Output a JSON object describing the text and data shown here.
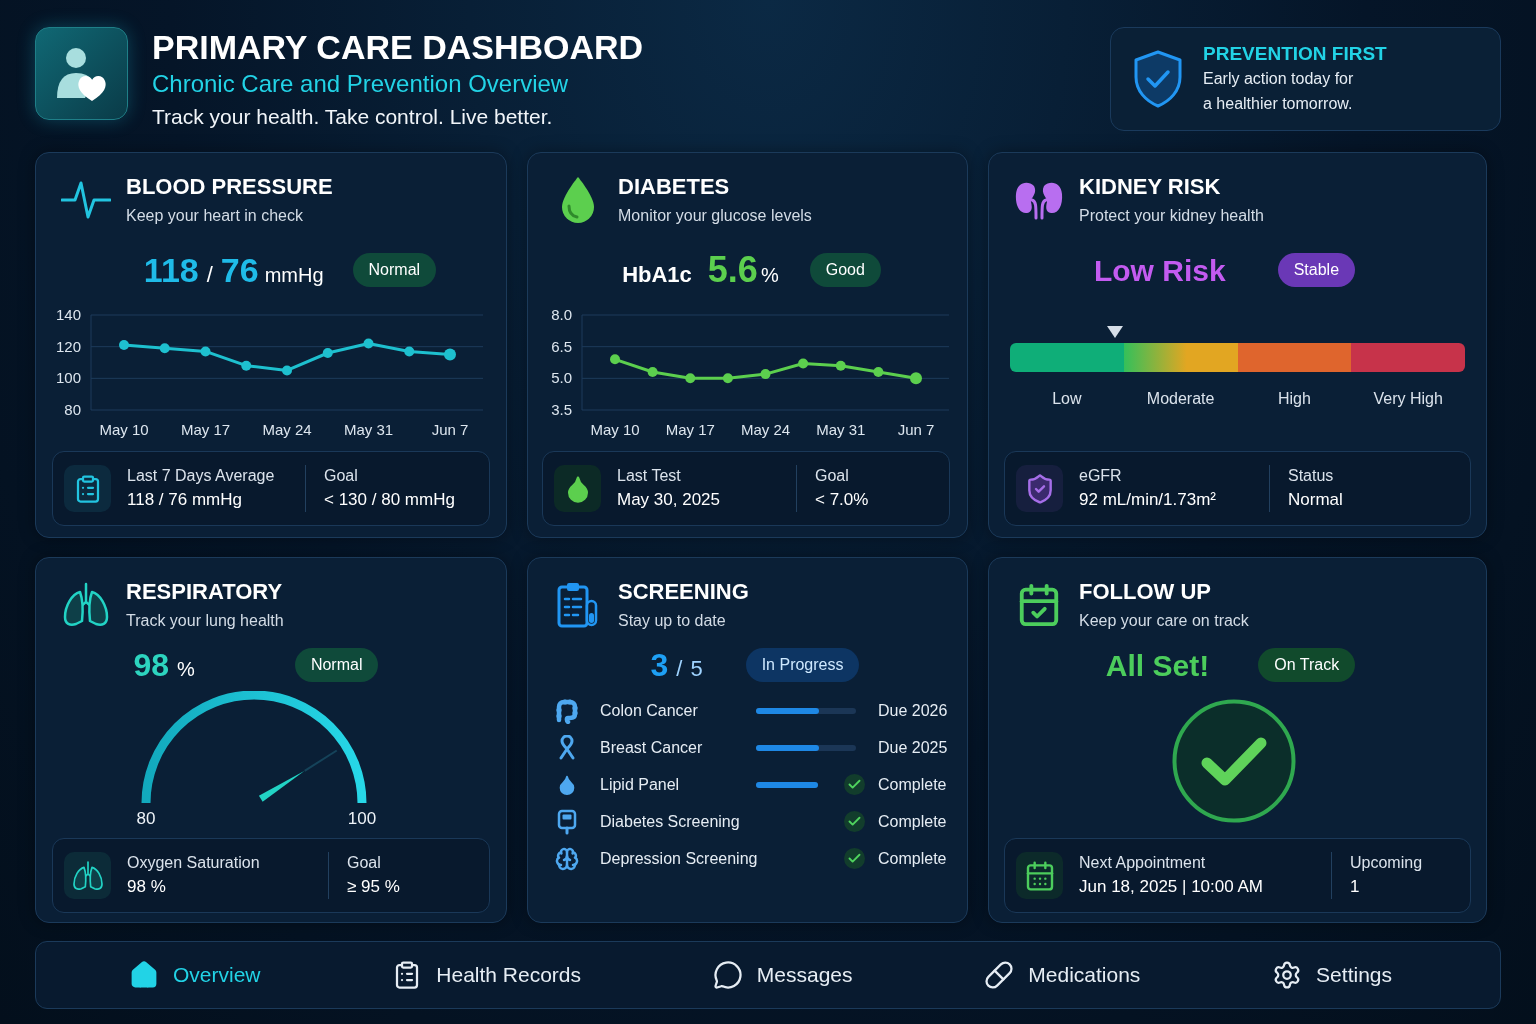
{
  "header": {
    "title": "PRIMARY CARE DASHBOARD",
    "subtitle": "Chronic Care and Prevention Overview",
    "tagline": "Track your health. Take control. Live better."
  },
  "prevention": {
    "title": "PREVENTION FIRST",
    "lines": [
      "Early action today for",
      "a healthier tomorrow."
    ]
  },
  "blood_pressure": {
    "title": "BLOOD PRESSURE",
    "subtitle": "Keep your heart in check",
    "reading": {
      "systolic": "118",
      "separator": "/",
      "diastolic": "76",
      "unit": "mmHg"
    },
    "badge": "Normal",
    "chart_data": {
      "type": "line",
      "marker": "circle",
      "categories": [
        "May 10",
        null,
        "May 17",
        null,
        "May 24",
        null,
        "May 31",
        null,
        "Jun 7"
      ],
      "values": [
        121,
        119,
        117,
        108,
        105,
        116,
        122,
        117,
        115
      ],
      "ylim": [
        80,
        140
      ],
      "yticks": [
        80,
        100,
        120,
        140
      ]
    },
    "summary": [
      {
        "label": "Last 7 Days Average",
        "value": "118 / 76 mmHg"
      },
      {
        "label": "Goal",
        "value": "< 130 / 80 mmHg"
      }
    ]
  },
  "diabetes": {
    "title": "DIABETES",
    "subtitle": "Monitor your glucose levels",
    "reading": {
      "label": "HbA1c",
      "value": "5.6",
      "unit": "%"
    },
    "badge": "Good",
    "chart_data": {
      "type": "line",
      "marker": "circle",
      "categories": [
        "May 10",
        null,
        "May 17",
        null,
        "May 24",
        null,
        "May 31",
        null,
        "Jun 7"
      ],
      "values": [
        5.9,
        5.3,
        5.0,
        5.0,
        5.2,
        5.7,
        5.6,
        5.3,
        5.0
      ],
      "ylim": [
        3.5,
        8.0
      ],
      "yticks": [
        {
          "value": 3.5,
          "label": "3.5"
        },
        {
          "value": 5,
          "label": "5.0"
        },
        {
          "value": 6.5,
          "label": "6.5"
        },
        {
          "value": 8,
          "label": "8.0"
        }
      ]
    },
    "summary": [
      {
        "label": "Last Test",
        "value": "May 30, 2025"
      },
      {
        "label": "Goal",
        "value": "< 7.0%"
      }
    ]
  },
  "kidney_risk": {
    "title": "KIDNEY RISK",
    "subtitle": "Protect your kidney health",
    "reading": {
      "value": "Low Risk"
    },
    "badge": "Stable",
    "scale": {
      "level": 0.23,
      "segments": [
        {
          "label": "Low",
          "color": "#0fae78"
        },
        {
          "label": "Moderate",
          "color": "#e2a622"
        },
        {
          "label": "High",
          "color": "#df652d"
        },
        {
          "label": "Very High",
          "color": "#c7334a"
        }
      ]
    },
    "summary": [
      {
        "label": "eGFR",
        "value": "92 mL/min/1.73m²"
      },
      {
        "label": "Status",
        "value": "Normal"
      }
    ]
  },
  "respiratory": {
    "title": "RESPIRATORY",
    "subtitle": "Track your lung health",
    "reading": {
      "value": "98",
      "unit": "%"
    },
    "badge": "Normal",
    "gauge": {
      "level": 0.82,
      "min_label": "80",
      "max_label": "100"
    },
    "summary": [
      {
        "label": "Oxygen Saturation",
        "value": "98 %"
      },
      {
        "label": "Goal",
        "value": "≥ 95 %"
      }
    ]
  },
  "screening": {
    "title": "SCREENING",
    "subtitle": "Stay up to date",
    "reading": {
      "done": "3",
      "separator": "/",
      "total": "5"
    },
    "badge": "In Progress",
    "items": [
      {
        "name": "Colon Cancer",
        "level": 0.63,
        "complete": false,
        "status": "Due 2026"
      },
      {
        "name": "Breast Cancer",
        "level": 0.63,
        "complete": false,
        "status": "Due 2025"
      },
      {
        "name": "Lipid Panel",
        "level": 1,
        "complete": true,
        "status": "Complete"
      },
      {
        "name": "Diabetes Screening",
        "complete": true,
        "status": "Complete"
      },
      {
        "name": "Depression Screening",
        "complete": true,
        "status": "Complete"
      }
    ]
  },
  "follow_up": {
    "title": "FOLLOW UP",
    "subtitle": "Keep your care on track",
    "reading": {
      "value": "All Set!"
    },
    "badge": "On Track",
    "summary": [
      {
        "label": "Next Appointment",
        "value": "Jun 18, 2025 | 10:00 AM"
      },
      {
        "label": "Upcoming",
        "value": "1"
      }
    ]
  },
  "nav": [
    {
      "label": "Overview",
      "selected": true
    },
    {
      "label": "Health Records",
      "selected": false
    },
    {
      "label": "Messages",
      "selected": false
    },
    {
      "label": "Medications",
      "selected": false
    },
    {
      "label": "Settings",
      "selected": false
    }
  ]
}
